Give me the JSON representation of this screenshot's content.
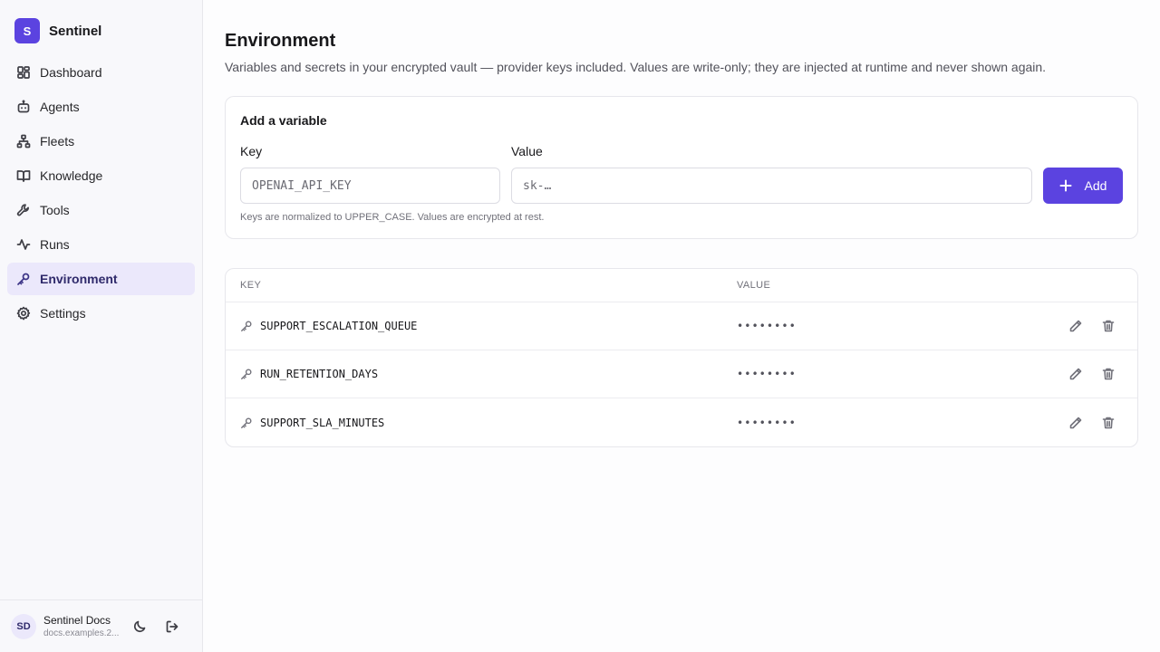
{
  "brand": {
    "logo_letter": "S",
    "name": "Sentinel",
    "accent": "#5b43e0"
  },
  "sidebar": {
    "items": [
      {
        "label": "Dashboard",
        "icon": "dashboard-icon"
      },
      {
        "label": "Agents",
        "icon": "bot-icon"
      },
      {
        "label": "Fleets",
        "icon": "network-icon"
      },
      {
        "label": "Knowledge",
        "icon": "book-icon"
      },
      {
        "label": "Tools",
        "icon": "wrench-icon"
      },
      {
        "label": "Runs",
        "icon": "activity-icon"
      },
      {
        "label": "Environment",
        "icon": "key-icon",
        "active": true
      },
      {
        "label": "Settings",
        "icon": "gear-icon"
      }
    ]
  },
  "user": {
    "initials": "SD",
    "name": "Sentinel Docs",
    "host": "docs.examples.2..."
  },
  "page": {
    "title": "Environment",
    "description": "Variables and secrets in your encrypted vault — provider keys included. Values are write-only; they are injected at runtime and never shown again."
  },
  "form": {
    "title": "Add a variable",
    "key_label": "Key",
    "key_placeholder": "OPENAI_API_KEY",
    "key_value": "",
    "value_label": "Value",
    "value_placeholder": "sk-…",
    "value_value": "",
    "add_label": "Add",
    "hint": "Keys are normalized to UPPER_CASE. Values are encrypted at rest."
  },
  "table": {
    "columns": {
      "key": "KEY",
      "value": "VALUE"
    },
    "rows": [
      {
        "key": "SUPPORT_ESCALATION_QUEUE",
        "value": "••••••••"
      },
      {
        "key": "RUN_RETENTION_DAYS",
        "value": "••••••••"
      },
      {
        "key": "SUPPORT_SLA_MINUTES",
        "value": "••••••••"
      }
    ]
  }
}
